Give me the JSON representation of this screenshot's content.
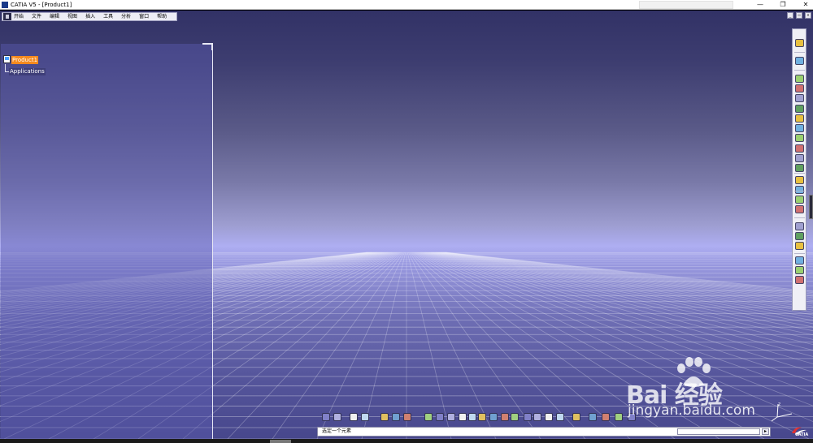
{
  "window": {
    "title": "CATIA V5 - [Product1]",
    "minimize_glyph": "—",
    "maximize_glyph": "❐",
    "close_glyph": "✕"
  },
  "menubar": {
    "items": [
      "开始",
      "文件",
      "编辑",
      "视图",
      "插入",
      "工具",
      "分析",
      "窗口",
      "帮助"
    ]
  },
  "mdi": {
    "minimize_glyph": "_",
    "restore_glyph": "▫",
    "close_glyph": "x"
  },
  "tree": {
    "root": {
      "label": "Product1",
      "icon": "product-icon"
    },
    "children": [
      {
        "label": "Applications"
      }
    ]
  },
  "status": {
    "message": "选定一个元素",
    "command_value": "",
    "command_button_glyph": "▸"
  },
  "watermark": {
    "logo_text": "Bai  经验",
    "site_text": "jingyan.baidu.com"
  },
  "brand": {
    "text": "CATIA"
  },
  "compass": {
    "x_label": "x",
    "y_label": "y",
    "z_label": "z"
  },
  "colors": {
    "selected_tree_item": "#f58a1e",
    "viewport_top": "#323266",
    "viewport_horizon": "#aeaef2",
    "viewport_bottom": "#47478c"
  },
  "right_toolbar_icons": [
    "select-arrow-icon",
    "fly-mode-icon",
    "new-component-icon",
    "new-product-icon",
    "new-part-icon",
    "existing-component-icon",
    "replace-component-icon",
    "graph-tree-reorder-icon",
    "generate-numbering-icon",
    "selective-load-icon",
    "manage-representations-icon",
    "multi-instantiation-icon",
    "manipulation-icon",
    "snap-icon",
    "explode-icon",
    "stop-manipulate-icon",
    "coincidence-constraint-icon",
    "contact-constraint-icon",
    "offset-constraint-icon",
    "scenes-icon",
    "analyze-icon",
    "catalog-icon"
  ],
  "bottom_toolbar_icons": [
    "knowledge-icon",
    "formula-icon",
    "fx-icon",
    "comment-icon",
    "table-icon",
    "tree-icon",
    "update-icon",
    "select-icon",
    "fit-all-icon",
    "pan-icon",
    "rotate-icon",
    "zoom-in-icon",
    "zoom-out-icon",
    "normal-view-icon",
    "view-mode-icon",
    "render-style-icon",
    "hide-show-icon",
    "swap-space-icon",
    "measure-icon",
    "axis-icon",
    "sectioning-icon",
    "clash-icon",
    "distance-icon",
    "bill-of-material-icon",
    "properties-icon"
  ]
}
